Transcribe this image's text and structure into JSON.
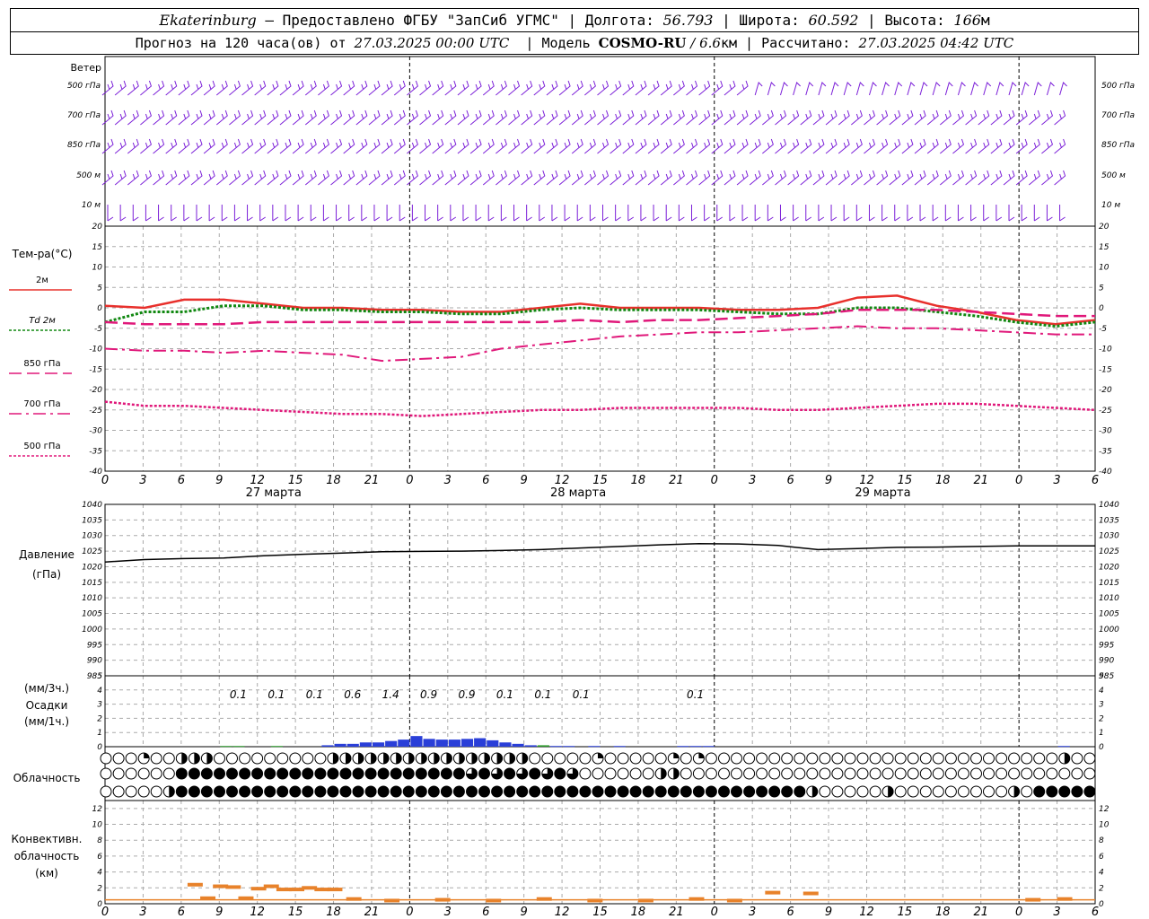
{
  "header": {
    "station": "Ekaterinburg",
    "provider": " – Предоставлено ФГБУ \"ЗапСиб УГМС\" | ",
    "lon_label": "Долгота: ",
    "lon": "56.793",
    "lat_label": " | Широта: ",
    "lat": "60.592",
    "alt_label": " | Высота: ",
    "alt": "166",
    "alt_unit": "м",
    "forecast_prefix": "Прогноз на 120 часа(ов) от ",
    "forecast_time": "27.03.2025 00:00 UTC",
    "model_label": "  | Модель ",
    "model_name": "COSMO-RU",
    "model_res": " / 6.6",
    "model_res_unit": "км",
    "calc_label": " | Рассчитано: ",
    "calc_time": "27.03.2025 04:42 UTC"
  },
  "labels": {
    "wind": "Ветер",
    "wind_levels": [
      "500 гПа",
      "700 гПа",
      "850 гПа",
      "500 м",
      "10  м"
    ],
    "temp_title": "Тем-ра(°С)",
    "temp_legend": [
      "2м",
      "Td  2м",
      "850 гПа",
      "700 гПа",
      "500 гПа"
    ],
    "pressure_title": "Давление",
    "pressure_unit": "(гПа)",
    "precip_units_3h": "(мм/3ч.)",
    "precip_title": "Осадки",
    "precip_units_1h": "(мм/1ч.)",
    "cloud_title": "Облачность",
    "conv_title": [
      "Конвективн.",
      "облачность",
      "(км)"
    ],
    "dates": [
      "27 марта",
      "28 марта",
      "29 марта"
    ]
  },
  "x_ticks": [
    "0",
    "3",
    "6",
    "9",
    "12",
    "15",
    "18",
    "21",
    "0",
    "3",
    "6",
    "9",
    "12",
    "15",
    "18",
    "21",
    "0",
    "3",
    "6",
    "9",
    "12",
    "15",
    "18",
    "21",
    "0",
    "3",
    "6"
  ],
  "colors": {
    "wind": "#7b1fd8",
    "t2m": "#e8302c",
    "td2m": "#118811",
    "t850": "#e0187a",
    "t700": "#e0187a",
    "t500": "#e0187a",
    "pressure": "#000000",
    "precip": "#2a3fd8",
    "precip_green": "#2a9a2a",
    "conv": "#e8822a",
    "grid": "#aaaaaa"
  },
  "chart_data": [
    {
      "type": "line",
      "panel": "temperature",
      "ylim": [
        -40,
        20
      ],
      "yticks": [
        20,
        15,
        10,
        5,
        0,
        -5,
        -10,
        -15,
        -20,
        -25,
        -30,
        -35,
        -40
      ],
      "x_hours": [
        0,
        3,
        6,
        9,
        12,
        15,
        18,
        21,
        24,
        27,
        30,
        33,
        36,
        39,
        42,
        45,
        48,
        51,
        54,
        57,
        60,
        63,
        66,
        69,
        72
      ],
      "series": [
        {
          "name": "2м",
          "values": [
            0.5,
            0,
            2,
            2,
            1,
            0,
            0,
            -0.5,
            -0.5,
            -1,
            -1,
            0,
            1,
            0,
            0,
            0,
            -0.5,
            -0.5,
            0,
            2.5,
            3,
            0.5,
            -1,
            -3,
            -4,
            -3
          ]
        },
        {
          "name": "Td  2м",
          "values": [
            -3.5,
            -1,
            -1,
            0.5,
            0.5,
            -0.5,
            -0.5,
            -1,
            -1,
            -1.5,
            -1.5,
            -0.5,
            0,
            -0.5,
            -0.5,
            -0.5,
            -1,
            -1.5,
            -1.5,
            0,
            0,
            -1,
            -2,
            -3.5,
            -4.5,
            -3.5
          ]
        },
        {
          "name": "850 гПа",
          "values": [
            -3.5,
            -4,
            -4,
            -4,
            -3.5,
            -3.5,
            -3.5,
            -3.5,
            -3.5,
            -3.5,
            -3.5,
            -3.5,
            -3,
            -3.5,
            -3,
            -3,
            -2.5,
            -2,
            -1.5,
            -0.5,
            -0.5,
            -0.5,
            -1,
            -1.5,
            -2,
            -2
          ]
        },
        {
          "name": "700 гПа",
          "values": [
            -10,
            -10.5,
            -10.5,
            -11,
            -10.5,
            -11,
            -11.5,
            -13,
            -12.5,
            -12,
            -10,
            -9,
            -8,
            -7,
            -6.5,
            -6,
            -6,
            -5.5,
            -5,
            -4.5,
            -5,
            -5,
            -5.5,
            -6,
            -6.5,
            -6.5
          ]
        },
        {
          "name": "500 гПа",
          "values": [
            -23,
            -24,
            -24,
            -24.5,
            -25,
            -25.5,
            -26,
            -26,
            -26.5,
            -26,
            -25.5,
            -25,
            -25,
            -24.5,
            -24.5,
            -24.5,
            -24.5,
            -25,
            -25,
            -24.5,
            -24,
            -23.5,
            -23.5,
            -24,
            -24.5,
            -25
          ]
        }
      ]
    },
    {
      "type": "line",
      "panel": "pressure",
      "ylim": [
        985,
        1040
      ],
      "yticks": [
        1040,
        1035,
        1030,
        1025,
        1020,
        1015,
        1010,
        1005,
        1000,
        995,
        990,
        985
      ],
      "series": [
        {
          "name": "",
          "values": [
            1021.5,
            1022.3,
            1022.6,
            1022.8,
            1023.5,
            1024,
            1024.4,
            1024.8,
            1024.9,
            1025,
            1025.2,
            1025.5,
            1026,
            1026.5,
            1027,
            1027.4,
            1027.3,
            1026.8,
            1025.5,
            1025.8,
            1026.2,
            1026.3,
            1026.5,
            1026.7,
            1026.7,
            1026.7
          ]
        }
      ]
    },
    {
      "type": "bar",
      "panel": "precipitation",
      "ylim": [
        0,
        5
      ],
      "yticks": [
        5,
        4,
        3,
        2,
        1,
        0
      ],
      "labels_3h": [
        "0.1",
        "0.1",
        "0.1",
        "0.6",
        "1.4",
        "0.9",
        "0.9",
        "0.1",
        "0.1",
        "0.1",
        "0.1"
      ],
      "labels_3h_hours": [
        10.5,
        13.5,
        16.5,
        19.5,
        22.5,
        25.5,
        28.5,
        31.5,
        34.5,
        37.5,
        46.5
      ],
      "hourly": [
        [
          9,
          0.05
        ],
        [
          10,
          0.05
        ],
        [
          13,
          0.05
        ],
        [
          17,
          0.1
        ],
        [
          18,
          0.2
        ],
        [
          19,
          0.2
        ],
        [
          20,
          0.3
        ],
        [
          21,
          0.3
        ],
        [
          22,
          0.4
        ],
        [
          23,
          0.5
        ],
        [
          24,
          0.75
        ],
        [
          25,
          0.55
        ],
        [
          26,
          0.5
        ],
        [
          27,
          0.5
        ],
        [
          28,
          0.55
        ],
        [
          29,
          0.6
        ],
        [
          30,
          0.45
        ],
        [
          31,
          0.3
        ],
        [
          32,
          0.2
        ],
        [
          33,
          0.1
        ],
        [
          34,
          0.1
        ],
        [
          35,
          0.05
        ],
        [
          36,
          0.05
        ],
        [
          38,
          0.05
        ],
        [
          40,
          0.05
        ],
        [
          45,
          0.05
        ],
        [
          46,
          0.05
        ],
        [
          47,
          0.05
        ],
        [
          75,
          0.05
        ]
      ]
    },
    {
      "type": "bar",
      "panel": "convective",
      "ylim": [
        0,
        13
      ],
      "yticks": [
        12,
        10,
        8,
        6,
        4,
        2,
        0
      ],
      "hourly": [
        [
          6.5,
          2.4
        ],
        [
          7.5,
          0.7
        ],
        [
          8.5,
          2.2
        ],
        [
          9.5,
          2.1
        ],
        [
          10.5,
          0.7
        ],
        [
          11.5,
          1.9
        ],
        [
          12.5,
          2.2
        ],
        [
          13.5,
          1.8
        ],
        [
          14.5,
          1.8
        ],
        [
          15.5,
          2.0
        ],
        [
          16.5,
          1.8
        ],
        [
          17.5,
          1.8
        ],
        [
          19,
          0.6
        ],
        [
          22,
          0.4
        ],
        [
          26,
          0.5
        ],
        [
          30,
          0.4
        ],
        [
          34,
          0.6
        ],
        [
          38,
          0.4
        ],
        [
          42,
          0.4
        ],
        [
          46,
          0.6
        ],
        [
          49,
          0.4
        ],
        [
          52,
          1.4
        ],
        [
          55,
          1.3
        ],
        [
          72.5,
          0.5
        ],
        [
          75,
          0.6
        ]
      ]
    }
  ]
}
